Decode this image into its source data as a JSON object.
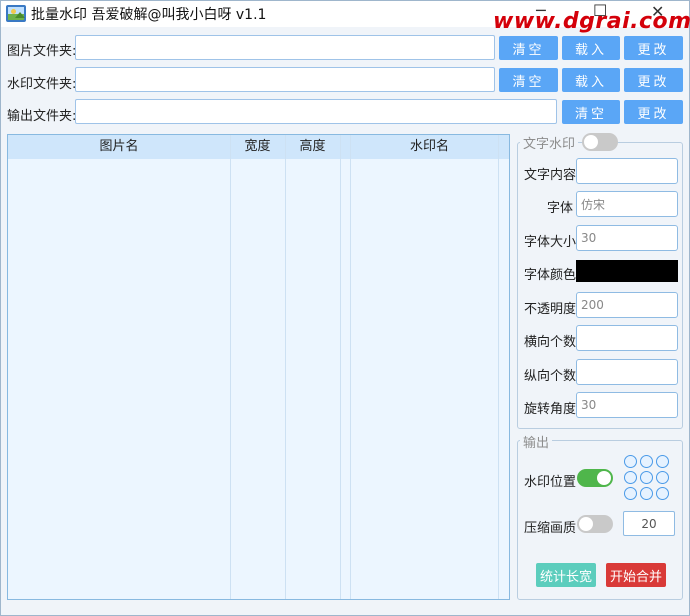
{
  "window": {
    "title": "批量水印 吾爱破解@叫我小白呀 v1.1",
    "watermark": "www.dgrai.com",
    "minimize": "─",
    "maximize": "☐",
    "close": "✕"
  },
  "paths": [
    {
      "label": "图片文件夹:",
      "value": "",
      "clear": "清空",
      "load": "载入",
      "change": "更改"
    },
    {
      "label": "水印文件夹:",
      "value": "",
      "clear": "清空",
      "load": "载入",
      "change": "更改"
    },
    {
      "label": "输出文件夹:",
      "value": "",
      "clear": "清空",
      "change": "更改"
    }
  ],
  "table": {
    "columns": [
      "图片名",
      "宽度",
      "高度",
      "",
      "水印名"
    ],
    "rows": []
  },
  "text_watermark": {
    "title": "文字水印",
    "enabled": false,
    "fields": {
      "content": {
        "label": "文字内容",
        "value": ""
      },
      "font": {
        "label": "字体",
        "value": "仿宋"
      },
      "size": {
        "label": "字体大小",
        "value": "30"
      },
      "color": {
        "label": "字体颜色",
        "value": "#000000"
      },
      "opacity": {
        "label": "不透明度",
        "value": "200"
      },
      "h_count": {
        "label": "横向个数",
        "value": ""
      },
      "v_count": {
        "label": "纵向个数",
        "value": ""
      },
      "rotation": {
        "label": "旋转角度",
        "value": "30"
      }
    }
  },
  "output": {
    "title": "输出",
    "position_label": "水印位置",
    "position_enabled": true,
    "compress_label": "压缩画质",
    "compress_enabled": false,
    "quality": "20",
    "stat_button": "统计长宽",
    "start_button": "开始合并"
  },
  "colors": {
    "button_blue": "#5aa6f6",
    "stat_button": "#5ccdbd",
    "start_button": "#d93a38",
    "toggle_on": "#4fb64b",
    "watermark_red": "#d4000a"
  }
}
